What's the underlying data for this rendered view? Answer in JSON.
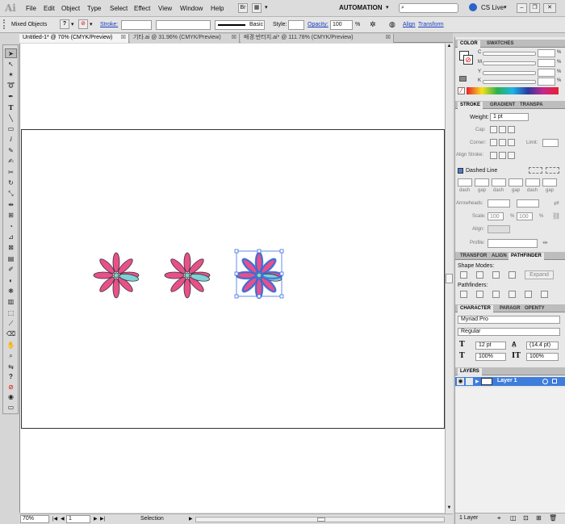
{
  "app": {
    "logo": "Ai"
  },
  "menu": {
    "items": [
      "File",
      "Edit",
      "Object",
      "Type",
      "Select",
      "Effect",
      "View",
      "Window",
      "Help"
    ]
  },
  "top_right": {
    "workspace": "AUTOMATION",
    "cs_live": "CS Live"
  },
  "control_bar": {
    "selection_label": "Mixed Objects",
    "stroke_label": "Stroke:",
    "brush_label": "Basic",
    "style_label": "Style:",
    "opacity_label": "Opacity:",
    "opacity_value": "100",
    "opacity_unit": "%",
    "align_link": "Align",
    "transform_link": "Transform"
  },
  "doc_tabs": [
    {
      "label": "Untitled-1* @ 70% (CMYK/Preview)",
      "active": true
    },
    {
      "label": "기타.ai @ 31.96% (CMYK/Preview)",
      "active": false
    },
    {
      "label": "배경:반터지.ai* @ 111.78% (CMYK/Preview)",
      "active": false
    }
  ],
  "status_bar": {
    "zoom": "70%",
    "page": "1",
    "status": "Selection"
  },
  "color_panel": {
    "tabs": [
      "COLOR",
      "SWATCHES"
    ],
    "channels": [
      {
        "label": "C",
        "unit": "%"
      },
      {
        "label": "M",
        "unit": "%"
      },
      {
        "label": "Y",
        "unit": "%"
      },
      {
        "label": "K",
        "unit": "%"
      }
    ]
  },
  "stroke_panel": {
    "tabs": [
      "STROKE",
      "GRADIENT",
      "TRANSPA"
    ],
    "weight_label": "Weight:",
    "weight_value": "1 pt",
    "cap_label": "Cap:",
    "corner_label": "Corner:",
    "limit_label": "Limit:",
    "align_stroke_label": "Align Stroke:",
    "dashed_line_label": "Dashed Line",
    "dash_labels": [
      "dash",
      "gap",
      "dash",
      "gap",
      "dash",
      "gap"
    ],
    "arrowheads_label": "Arrowheads:",
    "scale_label": "Scale:",
    "scale_value_1": "100",
    "scale_value_2": "100",
    "percent": "%",
    "align_label": "Align:",
    "profile_label": "Profile:"
  },
  "pathfinder_panel": {
    "tabs": [
      "TRANSFOR",
      "ALIGN",
      "PATHFINDER"
    ],
    "shape_modes_label": "Shape Modes:",
    "expand_label": "Expand",
    "pathfinders_label": "Pathfinders:"
  },
  "character_panel": {
    "tabs": [
      "CHARACTER",
      "PARAGR",
      "OPENTY"
    ],
    "font_family": "Myriad Pro",
    "font_style": "Regular",
    "font_size": "12 pt",
    "leading": "(14.4 pt)",
    "horizontal_scale": "100%",
    "vertical_scale": "100%"
  },
  "layers_panel": {
    "title": "LAYERS",
    "layer_name": "Layer 1",
    "footer_count": "1 Layer"
  },
  "colors": {
    "petal_pink": "#e8508a",
    "petal_teal": "#7fd1d6",
    "selection_blue": "#3b6fe0",
    "layer_highlight": "#3d7ddc"
  }
}
